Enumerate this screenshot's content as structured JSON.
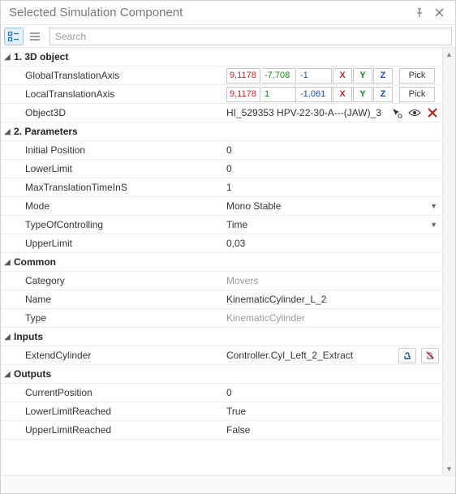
{
  "title": "Selected Simulation Component",
  "search": {
    "placeholder": "Search"
  },
  "sections": {
    "s1": "1. 3D object",
    "s2": "2. Parameters",
    "s3": "Common",
    "s4": "Inputs",
    "s5": "Outputs"
  },
  "obj3d": {
    "global_label": "GlobalTranslationAxis",
    "local_label": "LocalTranslationAxis",
    "object_label": "Object3D",
    "global": {
      "x": "9,1178",
      "y": "-7,708",
      "z": "-1"
    },
    "local": {
      "x": "9,1178",
      "y": "1",
      "z": "-1,061"
    },
    "axis_x": "X",
    "axis_y": "Y",
    "axis_z": "Z",
    "pick": "Pick",
    "object_value": "HI_529353 HPV-22-30-A---(JAW)_3"
  },
  "params": {
    "initial_pos_label": "Initial Position",
    "initial_pos": "0",
    "lower_limit_label": "LowerLimit",
    "lower_limit": "0",
    "max_time_label": "MaxTranslationTimeInS",
    "max_time": "1",
    "mode_label": "Mode",
    "mode": "Mono Stable",
    "type_ctrl_label": "TypeOfControlling",
    "type_ctrl": "Time",
    "upper_limit_label": "UpperLimit",
    "upper_limit": "0,03"
  },
  "common": {
    "category_label": "Category",
    "category": "Movers",
    "name_label": "Name",
    "name": "KinematicCylinder_L_2",
    "type_label": "Type",
    "type": "KinematicCylinder"
  },
  "inputs": {
    "extend_label": "ExtendCylinder",
    "extend_value": "Controller.Cyl_Left_2_Extract"
  },
  "outputs": {
    "curpos_label": "CurrentPosition",
    "curpos": "0",
    "lower_reached_label": "LowerLimitReached",
    "lower_reached": "True",
    "upper_reached_label": "UpperLimitReached",
    "upper_reached": "False"
  }
}
